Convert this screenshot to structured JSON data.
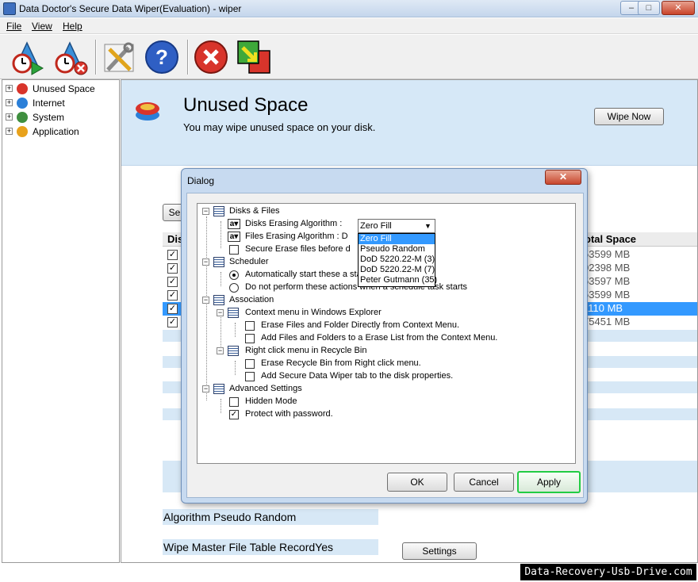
{
  "window": {
    "title": "Data Doctor's Secure Data Wiper(Evaluation) - wiper",
    "minimize": "–",
    "restore": "□",
    "close": "✕"
  },
  "menu": [
    "File",
    "View",
    "Help"
  ],
  "toolbar": {
    "icons": [
      "schedule-play-icon",
      "schedule-stop-icon",
      "settings-tools-icon",
      "help-icon",
      "stop-icon",
      "exit-icon"
    ]
  },
  "tree": {
    "items": [
      {
        "label": "Unused Space",
        "expander": "+",
        "icon_color": "#d8342b"
      },
      {
        "label": "Internet",
        "expander": "+",
        "icon_color": "#2b7fd8"
      },
      {
        "label": "System",
        "expander": "+",
        "icon_color": "#3f8f3f"
      },
      {
        "label": "Application",
        "expander": "+",
        "icon_color": "#e8a21c"
      }
    ]
  },
  "panel": {
    "title": "Unused Space",
    "description": "You may wipe unused space on your disk.",
    "wipe_button": "Wipe Now",
    "behind_button_fragment": "Se",
    "column_first_fragment": "Dis",
    "column_total": "otal Space",
    "rows": [
      {
        "checked": "✓",
        "size": "53599 MB",
        "selected": false
      },
      {
        "checked": "✓",
        "size": "02398 MB",
        "selected": false
      },
      {
        "checked": "✓",
        "size": "53597 MB",
        "selected": false
      },
      {
        "checked": "✓",
        "size": "53599 MB",
        "selected": false
      },
      {
        "checked": "✓",
        "size": "1110 MB",
        "selected": true
      },
      {
        "checked": "✓",
        "size": "75451 MB",
        "selected": false
      }
    ],
    "algorithm_label": "Algorithm Pseudo Random",
    "mft_label": "Wipe Master File Table RecordYes",
    "settings_button": "Settings"
  },
  "dialog": {
    "title": "Dialog",
    "close": "✕",
    "groups": {
      "disks_files": "Disks & Files",
      "disks_algo_label": "Disks Erasing Algorithm :",
      "files_algo_label": "Files Erasing Algorithm : D",
      "secure_erase": "Secure Erase files before d",
      "scheduler": "Scheduler",
      "auto_start": "Automatically start these a                                startup.",
      "do_not_perform": "Do not perform these actions when a schedule task starts",
      "association": "Association",
      "context_menu": "Context menu in Windows Explorer",
      "erase_files_ctx": "Erase Files and Folder Directly from Context Menu.",
      "add_files_ctx": "Add Files and Folders to a Erase List from the Context Menu.",
      "right_click": "Right click menu in Recycle Bin",
      "erase_recycle": "Erase Recycle Bin from Right click menu.",
      "add_tab": "Add Secure Data Wiper tab to the disk properties.",
      "advanced": "Advanced Settings",
      "hidden_mode": "Hidden Mode",
      "protect_pwd": "Protect with password.",
      "protect_checked": "✓"
    },
    "combo": {
      "value": "Zero Fill",
      "arrow": "▼",
      "options": [
        "Zero Fill",
        "Pseudo Random",
        "DoD 5220.22-M (3)",
        "DoD 5220.22-M (7)",
        "Peter Gutmann (35)"
      ],
      "highlighted": 0
    },
    "buttons": {
      "ok": "OK",
      "cancel": "Cancel",
      "apply": "Apply"
    }
  },
  "watermark": "Data-Recovery-Usb-Drive.com"
}
